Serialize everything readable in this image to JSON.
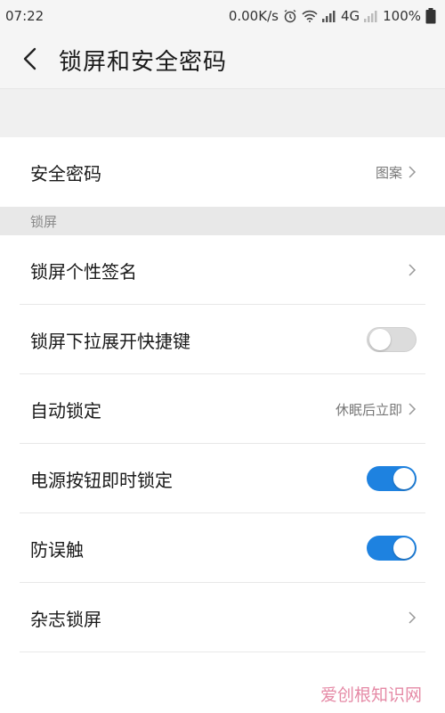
{
  "status_bar": {
    "time": "07:22",
    "net_speed": "0.00K/s",
    "network": "4G",
    "battery": "100%"
  },
  "header": {
    "title": "锁屏和安全密码",
    "back_icon": "chevron-left-icon"
  },
  "security": {
    "label": "安全密码",
    "value": "图案"
  },
  "lock_section": {
    "title": "锁屏",
    "items": [
      {
        "label": "锁屏个性签名",
        "type": "link",
        "value": ""
      },
      {
        "label": "锁屏下拉展开快捷键",
        "type": "toggle",
        "on": false
      },
      {
        "label": "自动锁定",
        "type": "link",
        "value": "休眠后立即"
      },
      {
        "label": "电源按钮即时锁定",
        "type": "toggle",
        "on": true
      },
      {
        "label": "防误触",
        "type": "toggle",
        "on": true
      },
      {
        "label": "杂志锁屏",
        "type": "link",
        "value": ""
      }
    ]
  },
  "watermark": "爱创根知识网",
  "colors": {
    "accent": "#1e82e0",
    "toggle_off": "#dcdcdc",
    "watermark": "#e58aa6"
  }
}
